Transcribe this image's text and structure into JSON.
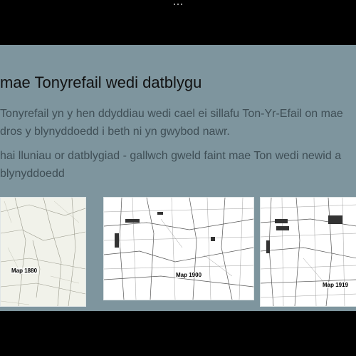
{
  "window": {
    "menu_icon": "more-dots-icon"
  },
  "slide": {
    "title": "mae Tonyrefail  wedi datblygu",
    "paragraph1_line1": "Tonyrefail yn y hen ddyddiau wedi cael ei sillafu Ton-Yr-Efail on mae",
    "paragraph1_line2": "dros y blynyddoedd i beth ni yn gwybod nawr.",
    "paragraph2_line1": "hai lluniau or datblygiad  - gallwch gweld faint mae Ton wedi newid a",
    "paragraph2_line2": "blynyddoedd",
    "maps": [
      {
        "label": "Map 1880"
      },
      {
        "label": "Map 1900"
      },
      {
        "label": "Map 1919"
      }
    ]
  },
  "colors": {
    "slide_background": "#7e959e",
    "page_background": "#000000",
    "title_text": "#111111",
    "body_text": "#3f4e55"
  }
}
